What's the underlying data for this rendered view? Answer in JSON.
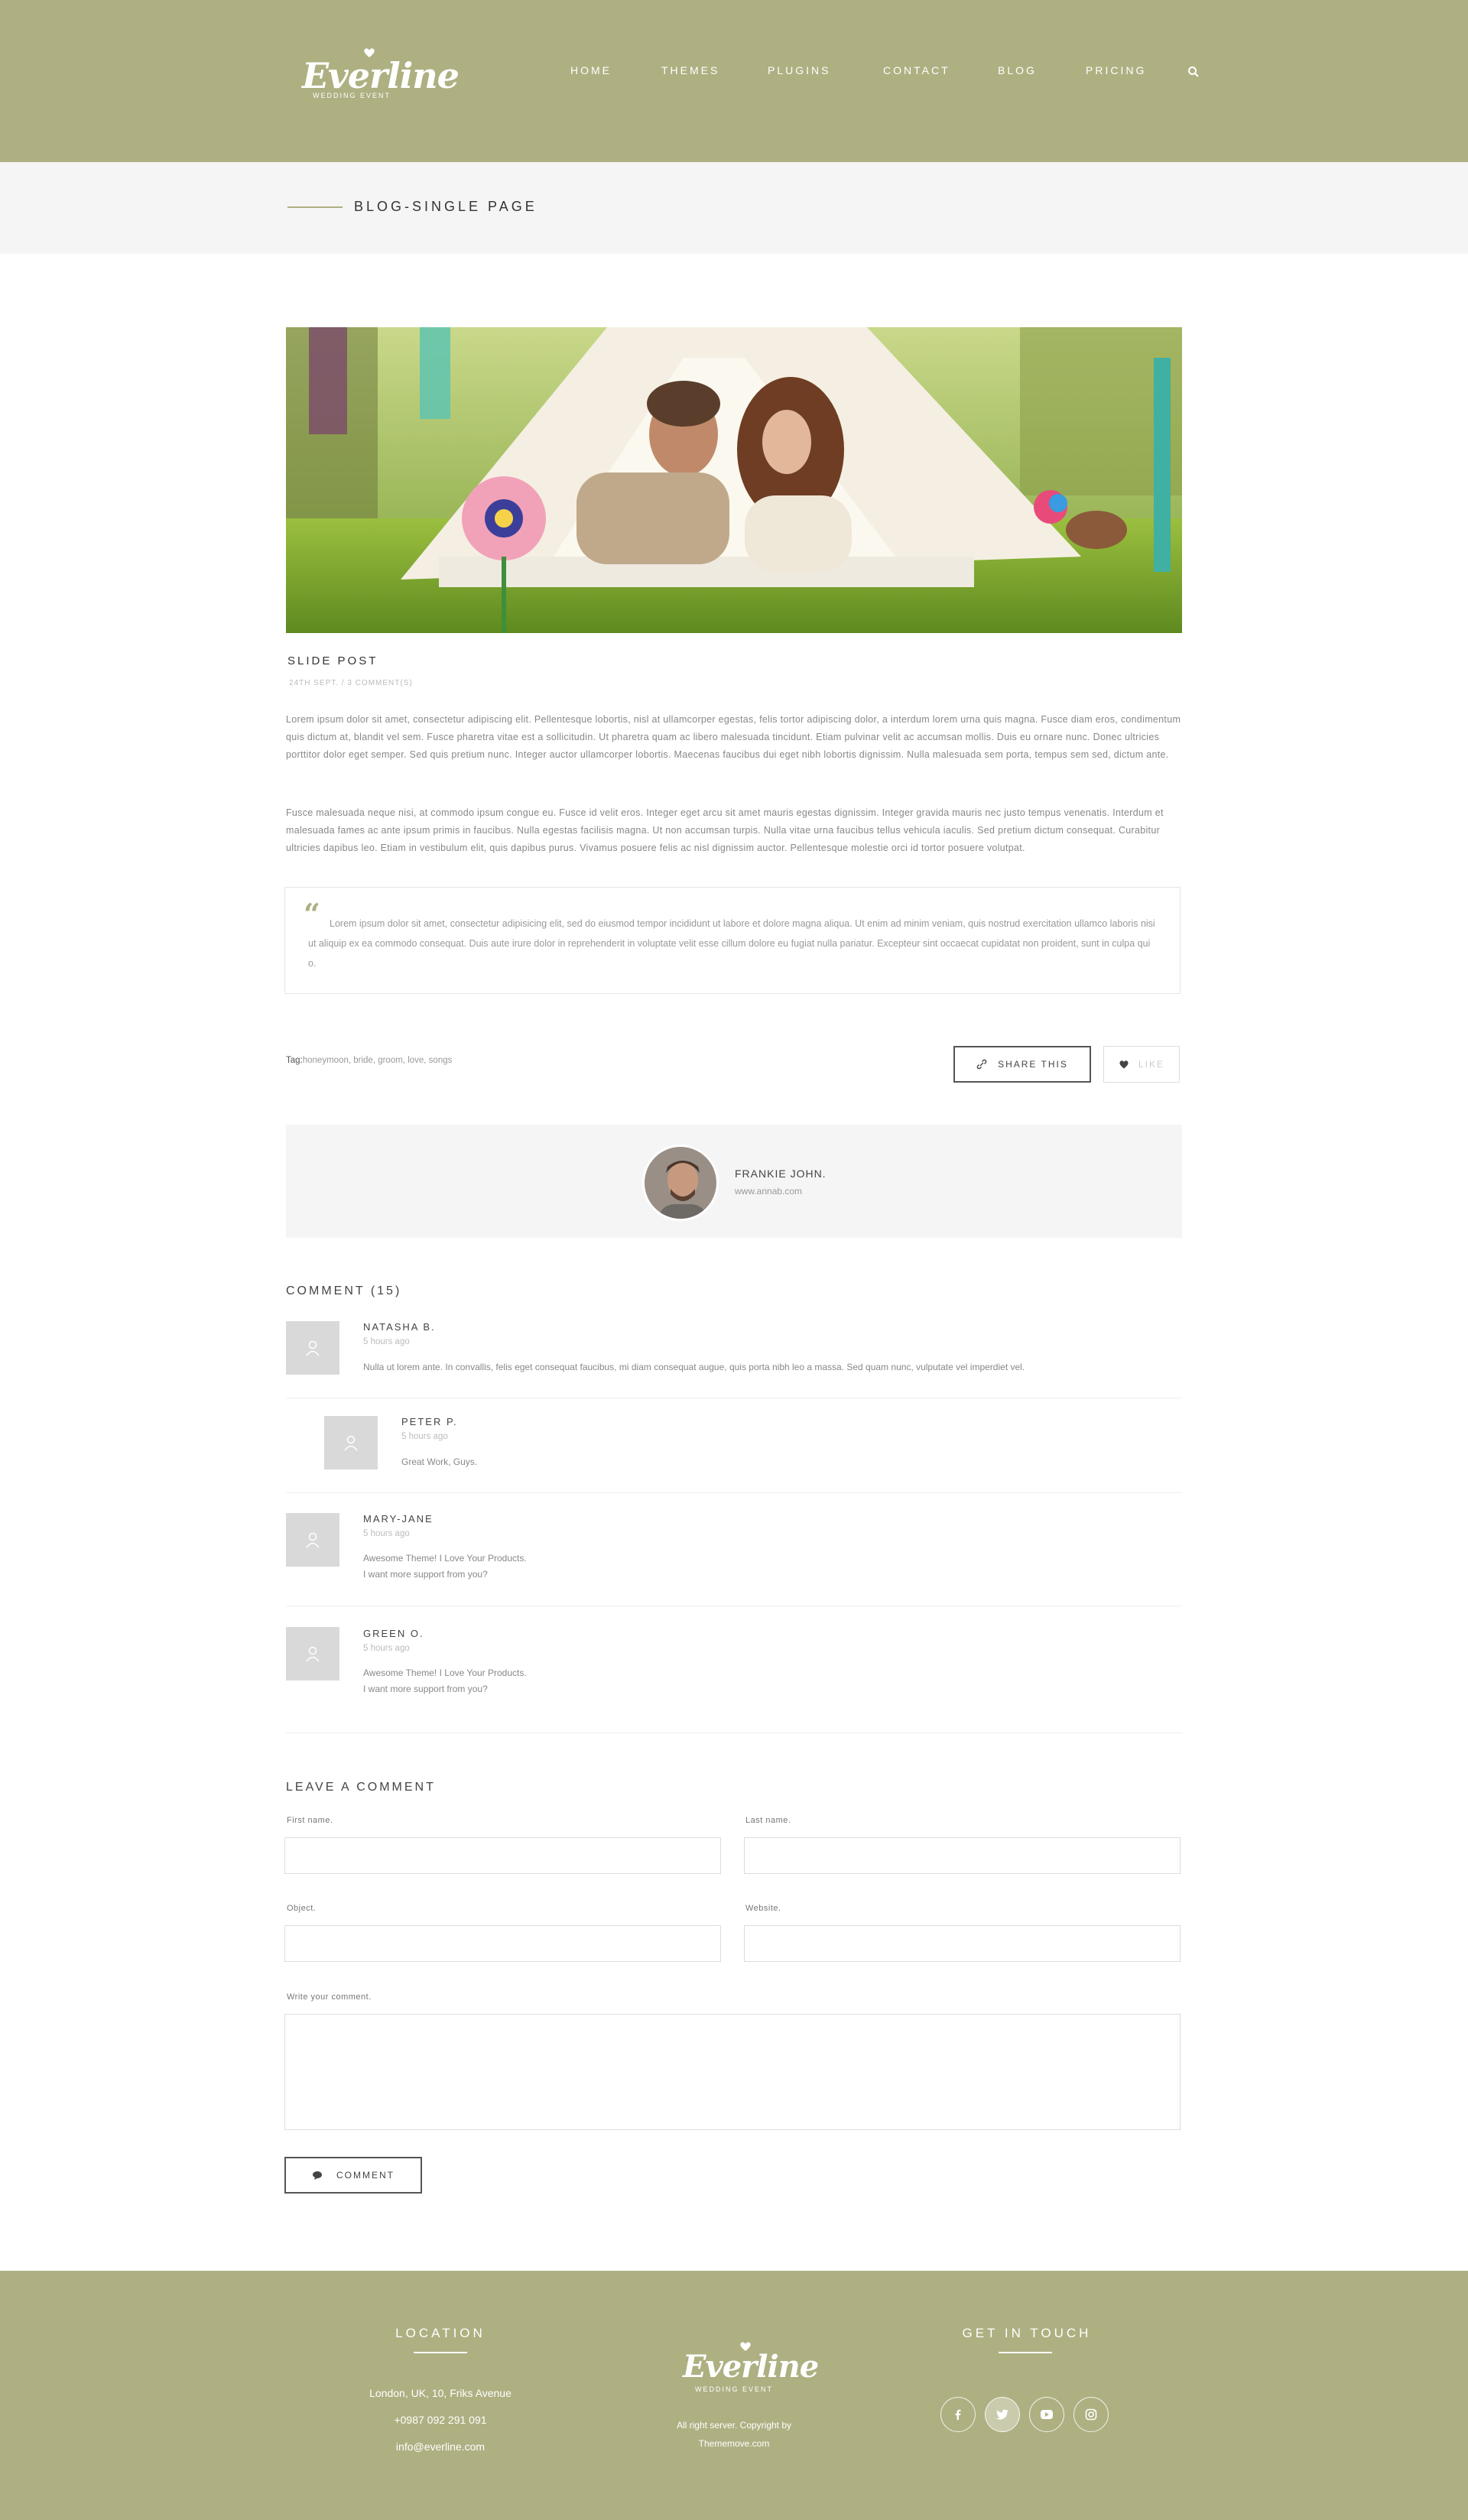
{
  "brand": {
    "name": "Everline",
    "tagline": "WEDDING EVENT"
  },
  "nav": {
    "items": [
      "HOME",
      "THEMES",
      "PLUGINS",
      "CONTACT",
      "BLOG",
      "PRICING"
    ]
  },
  "breadcrumb": {
    "title": "BLOG-SINGLE PAGE"
  },
  "post": {
    "title": "SLIDE POST",
    "meta": "24TH SEPT. / 3 COMMENT(S)",
    "paragraphs": [
      "Lorem ipsum dolor sit amet, consectetur adipiscing elit. Pellentesque lobortis, nisl at ullamcorper egestas, felis tortor adipiscing dolor, a interdum lorem urna quis magna. Fusce diam eros, condimentum quis dictum at, blandit vel sem. Fusce pharetra vitae est a sollicitudin. Ut pharetra quam ac libero malesuada tincidunt. Etiam pulvinar velit ac accumsan mollis. Duis eu ornare nunc. Donec ultricies porttitor dolor eget semper. Sed quis pretium nunc. Integer auctor ullamcorper lobortis. Maecenas faucibus dui eget nibh lobortis dignissim. Nulla malesuada sem porta, tempus sem sed, dictum ante.",
      "Fusce malesuada neque nisi, at commodo ipsum congue eu. Fusce id velit eros. Integer eget arcu sit amet mauris egestas dignissim. Integer gravida mauris nec justo tempus venenatis. Interdum et malesuada fames ac ante ipsum primis in faucibus. Nulla egestas facilisis magna. Ut non accumsan turpis. Nulla vitae urna faucibus tellus vehicula iaculis. Sed pretium dictum consequat. Curabitur ultricies dapibus leo. Etiam in vestibulum elit, quis dapibus purus. Vivamus posuere felis ac nisl dignissim auctor. Pellentesque molestie orci id tortor posuere volutpat."
    ],
    "quote": "Lorem ipsum dolor sit amet, consectetur adipisicing elit, sed do eiusmod tempor incididunt ut labore et dolore magna aliqua. Ut enim ad minim veniam, quis nostrud exercitation ullamco laboris nisi ut aliquip ex ea commodo consequat. Duis aute irure dolor in reprehenderit in voluptate velit esse cillum dolore eu fugiat nulla pariatur. Excepteur sint occaecat cupidatat non proident, sunt in culpa qui o.",
    "tags_label": "Tag:",
    "tags": "honeymoon, bride, groom, love, songs",
    "share_label": "SHARE THIS",
    "like_label": "LIKE"
  },
  "author": {
    "name": "FRANKIE JOHN.",
    "site": "www.annab.com"
  },
  "comments": {
    "title": "COMMENT (15)",
    "items": [
      {
        "name": "NATASHA B.",
        "time": "5 hours ago",
        "text": "Nulla ut lorem ante. In convallis, felis eget consequat faucibus, mi diam consequat augue, quis porta nibh leo a massa. Sed quam nunc, vulputate vel imperdiet vel."
      },
      {
        "name": "PETER P.",
        "time": "5 hours ago",
        "text": "Great Work, Guys."
      },
      {
        "name": "MARY-JANE",
        "time": "5 hours ago",
        "text": "Awesome Theme! I Love Your Products.",
        "text2": "I want more support from you?"
      },
      {
        "name": "GREEN O.",
        "time": "5 hours ago",
        "text": "Awesome Theme! I Love Your Products.",
        "text2": "I want more support from you?"
      }
    ]
  },
  "form": {
    "title": "LEAVE A COMMENT",
    "first_name": "First name.",
    "last_name": "Last name.",
    "object": "Object.",
    "website": "Website.",
    "comment": "Write your comment.",
    "submit": "COMMENT"
  },
  "footer": {
    "location_title": "LOCATION",
    "address": "London, UK, 10, Friks Avenue",
    "phone": "+0987 092 291 091",
    "email": "info@everline.com",
    "copyright_1": "All right server. Copyright by",
    "copyright_2": "Thememove.com",
    "touch_title": "GET IN TOUCH",
    "social": [
      "facebook",
      "twitter",
      "youtube",
      "instagram"
    ]
  },
  "colors": {
    "accent": "#aeb082",
    "bar": "#f5f5f5"
  }
}
